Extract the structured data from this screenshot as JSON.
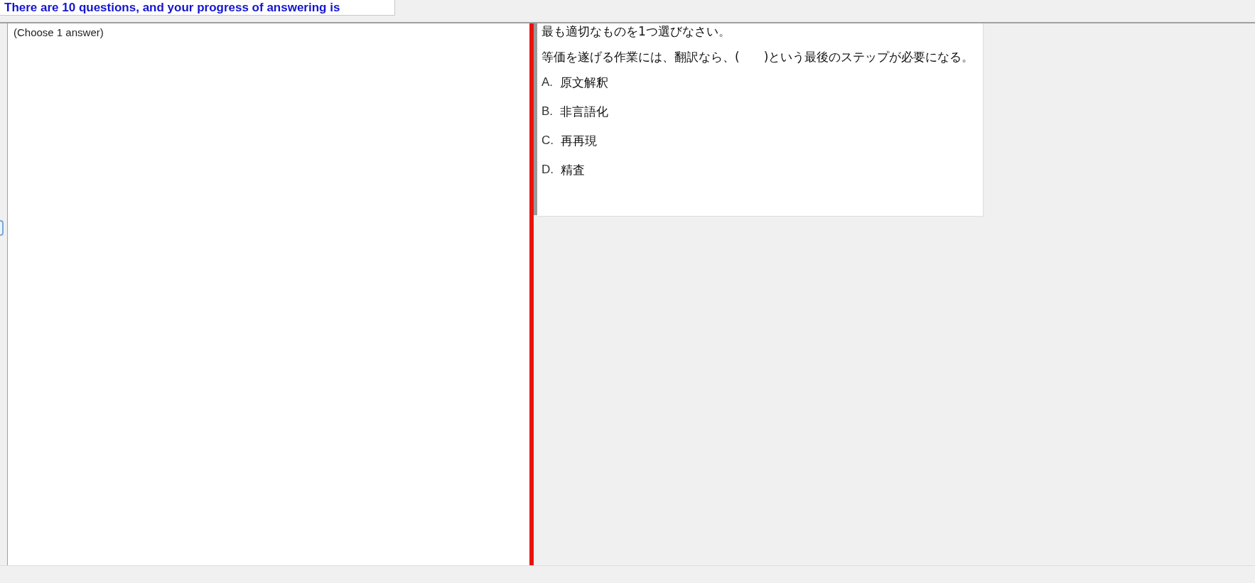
{
  "header": {
    "progress_text": "There are 10 questions, and your progress of answering is"
  },
  "left_panel": {
    "instruction": "(Choose 1 answer)"
  },
  "question": {
    "prompt": "最も適切なものを1つ選びなさい。",
    "sentence": "等価を遂げる作業には、翻訳なら、(　　)という最後のステップが必要になる。",
    "options": [
      {
        "letter": "A.",
        "text": "原文解釈"
      },
      {
        "letter": "B.",
        "text": "非言語化"
      },
      {
        "letter": "C.",
        "text": "再再現"
      },
      {
        "letter": "D.",
        "text": "精査"
      }
    ]
  }
}
